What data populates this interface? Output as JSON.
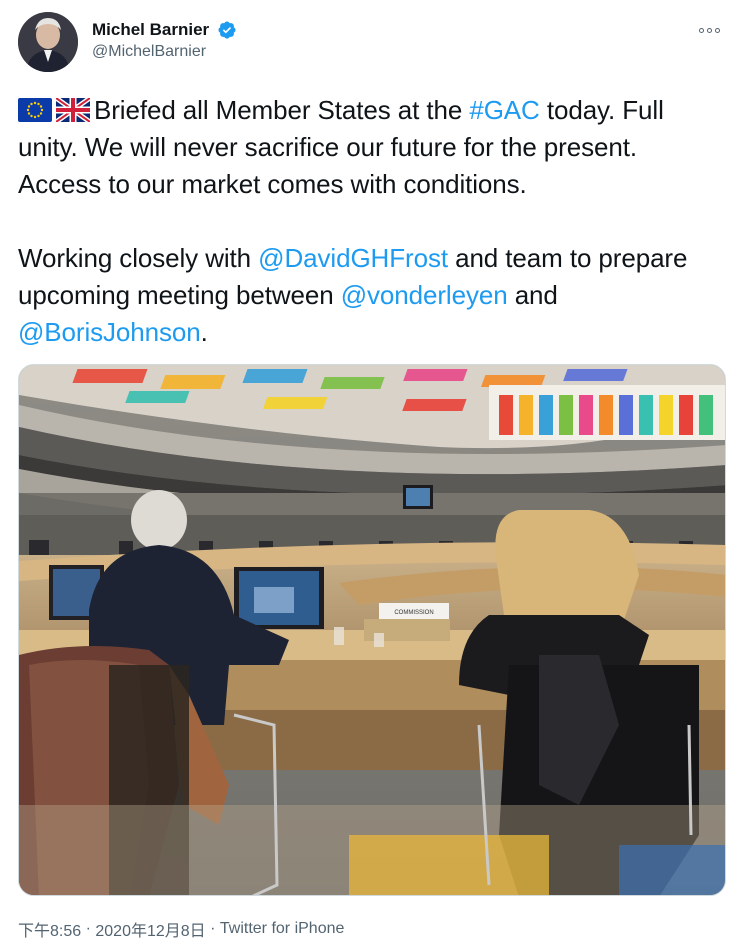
{
  "author": {
    "display_name": "Michel Barnier",
    "handle": "@MichelBarnier",
    "verified": true,
    "verified_color": "#1d9bf0"
  },
  "tweet": {
    "flags": [
      "eu-flag-icon",
      "uk-flag-icon"
    ],
    "line1_pre": "Briefed all Member States at the ",
    "hashtag": "#GAC",
    "line1_post": " today. Full unity. We will never sacrifice our future for the present. Access to our market comes with conditions.",
    "p2_pre": "Working closely with ",
    "mention1": "@DavidGHFrost",
    "p2_mid": " and team to prepare upcoming meeting between ",
    "mention2": "@vonderleyen",
    "p2_and": " and ",
    "mention3": "@BorisJohnson",
    "p2_end": "."
  },
  "photo": {
    "placard_text": "COMMISSION"
  },
  "meta": {
    "time": "下午8:56",
    "separator": " · ",
    "date": "2020年12月8日",
    "separator2": " · ",
    "source": "Twitter for iPhone"
  },
  "colors": {
    "link": "#1d9bf0",
    "secondary_text": "#536471",
    "primary_text": "#0f1419"
  },
  "icons": {
    "more": "more-horizontal-icon",
    "verified": "verified-badge-icon"
  }
}
